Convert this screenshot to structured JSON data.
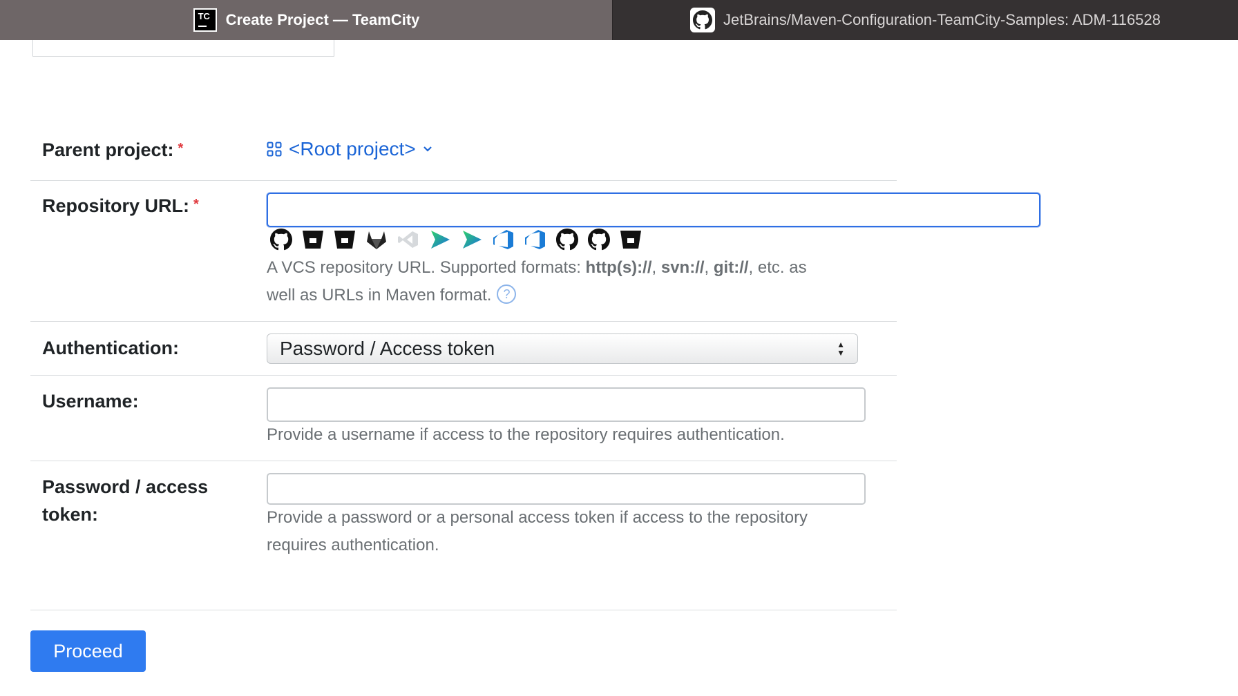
{
  "tabs": [
    {
      "title": "Create Project — TeamCity",
      "icon": "teamcity-logo-icon",
      "active": true
    },
    {
      "title": "JetBrains/Maven-Configuration-TeamCity-Samples: ADM-116528",
      "icon": "github-icon",
      "active": false
    }
  ],
  "tc_logo_text": "TC",
  "form": {
    "parent_project": {
      "label": "Parent project:",
      "required_mark": "*",
      "value": "<Root project>"
    },
    "repository_url": {
      "label": "Repository URL:",
      "required_mark": "*",
      "value": "",
      "vcs_icons": [
        "github-icon",
        "bitbucket-icon",
        "bitbucket-icon",
        "gitlab-icon",
        "visual-studio-icon",
        "space-icon",
        "space-icon",
        "azure-devops-icon",
        "azure-devops-icon",
        "github-icon",
        "github-icon",
        "bitbucket-icon"
      ],
      "help_prefix": "A VCS repository URL. Supported formats: ",
      "fmt1": "http(s)://",
      "sep1": ", ",
      "fmt2": "svn://",
      "sep2": ", ",
      "fmt3": "git://",
      "help_suffix": ", etc. as",
      "help_line2": "well as URLs in Maven format.",
      "help_icon": "?"
    },
    "authentication": {
      "label": "Authentication:",
      "selected": "Password / Access token"
    },
    "username": {
      "label": "Username:",
      "value": "",
      "help": "Provide a username if access to the repository requires authentication."
    },
    "password": {
      "label_line1": "Password / access",
      "label_line2": "token:",
      "value": "",
      "help_line1": "Provide a password or a personal access token if access to the repository",
      "help_line2": "requires authentication."
    }
  },
  "proceed_label": "Proceed",
  "colors": {
    "accent": "#2f7bf0",
    "required": "#e0393e",
    "link": "#1a64d6"
  }
}
